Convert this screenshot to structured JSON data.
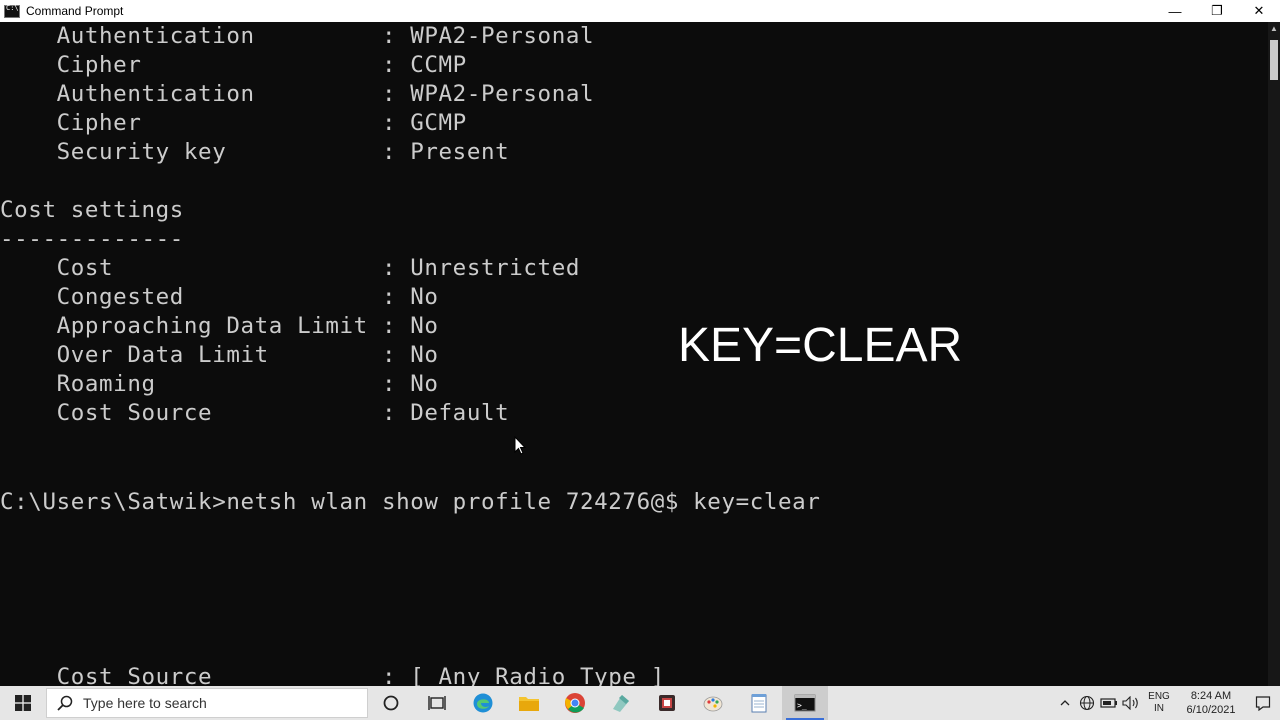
{
  "window": {
    "title": "Command Prompt",
    "minimize": "—",
    "restore": "❐",
    "close": "✕"
  },
  "console": {
    "lines": [
      "    Authentication         : WPA2-Personal",
      "    Cipher                 : CCMP",
      "    Authentication         : WPA2-Personal",
      "    Cipher                 : GCMP",
      "    Security key           : Present",
      "",
      "Cost settings",
      "-------------",
      "    Cost                   : Unrestricted",
      "    Congested              : No",
      "    Approaching Data Limit : No",
      "    Over Data Limit        : No",
      "    Roaming                : No",
      "    Cost Source            : Default",
      "",
      "",
      "C:\\Users\\Satwik>netsh wlan show profile 724276@$ key=clear",
      "",
      "",
      "",
      "",
      "",
      "    Cost Source            : [ Any Radio Type ]"
    ],
    "overlay_text": "KEY=CLEAR"
  },
  "taskbar": {
    "search_placeholder": "Type here to search",
    "language_line1": "ENG",
    "language_line2": "IN",
    "time": "8:24 AM",
    "date": "6/10/2021",
    "apps": [
      {
        "name": "cortana-icon"
      },
      {
        "name": "task-view-icon"
      },
      {
        "name": "edge-icon"
      },
      {
        "name": "file-explorer-icon"
      },
      {
        "name": "chrome-icon"
      },
      {
        "name": "app-icon-green"
      },
      {
        "name": "app-icon-media"
      },
      {
        "name": "paint-icon"
      },
      {
        "name": "notepad-icon"
      },
      {
        "name": "command-prompt-icon"
      }
    ]
  },
  "colors": {
    "console_bg": "#0c0c0c",
    "console_text": "#cccccc",
    "taskbar_bg": "#e6e6e6",
    "accent": "#3a6fd8"
  }
}
